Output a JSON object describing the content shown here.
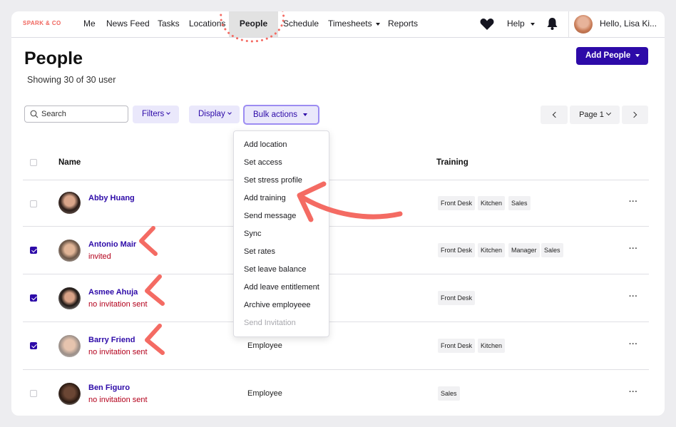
{
  "nav": {
    "logo": "SPARK & CO",
    "items": [
      "Me",
      "News Feed",
      "Tasks",
      "Locations",
      "People",
      "Schedule",
      "Timesheets",
      "Reports"
    ],
    "help": "Help",
    "user": "Hello, Lisa Ki..."
  },
  "page": {
    "title": "People",
    "subtitle": "Showing 30 of 30 user",
    "add_button": "Add People"
  },
  "toolbar": {
    "search_placeholder": "Search",
    "filters": "Filters",
    "display": "Display",
    "bulk": "Bulk actions",
    "page": "Page 1"
  },
  "table": {
    "col_name": "Name",
    "col_training": "Training",
    "rows": [
      {
        "name": "Abby Huang",
        "status": "",
        "role": "",
        "checked": false,
        "training": [
          "Front Desk",
          "Kitchen",
          "Sales"
        ]
      },
      {
        "name": "Antonio Mair",
        "status": "invited",
        "role": "",
        "checked": true,
        "training": [
          "Front Desk",
          "Kitchen",
          "Manager",
          "Sales"
        ]
      },
      {
        "name": "Asmee Ahuja",
        "status": "no invitation sent",
        "role": "",
        "checked": true,
        "training": [
          "Front Desk"
        ]
      },
      {
        "name": "Barry Friend",
        "status": "no invitation sent",
        "role": "Employee",
        "checked": true,
        "training": [
          "Front Desk",
          "Kitchen"
        ]
      },
      {
        "name": "Ben Figuro",
        "status": "no invitation sent",
        "role": "Employee",
        "checked": false,
        "training": [
          "Sales"
        ]
      }
    ],
    "more": "···"
  },
  "bulk_menu": {
    "items": [
      "Add location",
      "Set access",
      "Set stress profile",
      "Add training",
      "Send message",
      "Sync",
      "Set rates",
      "Set leave balance",
      "Add leave entitlement",
      "Archive employeee"
    ],
    "disabled_item": "Send Invitation"
  },
  "colors": {
    "accent": "#2d0aa8",
    "annotation": "#f46b63",
    "status_red": "#b3001b"
  }
}
